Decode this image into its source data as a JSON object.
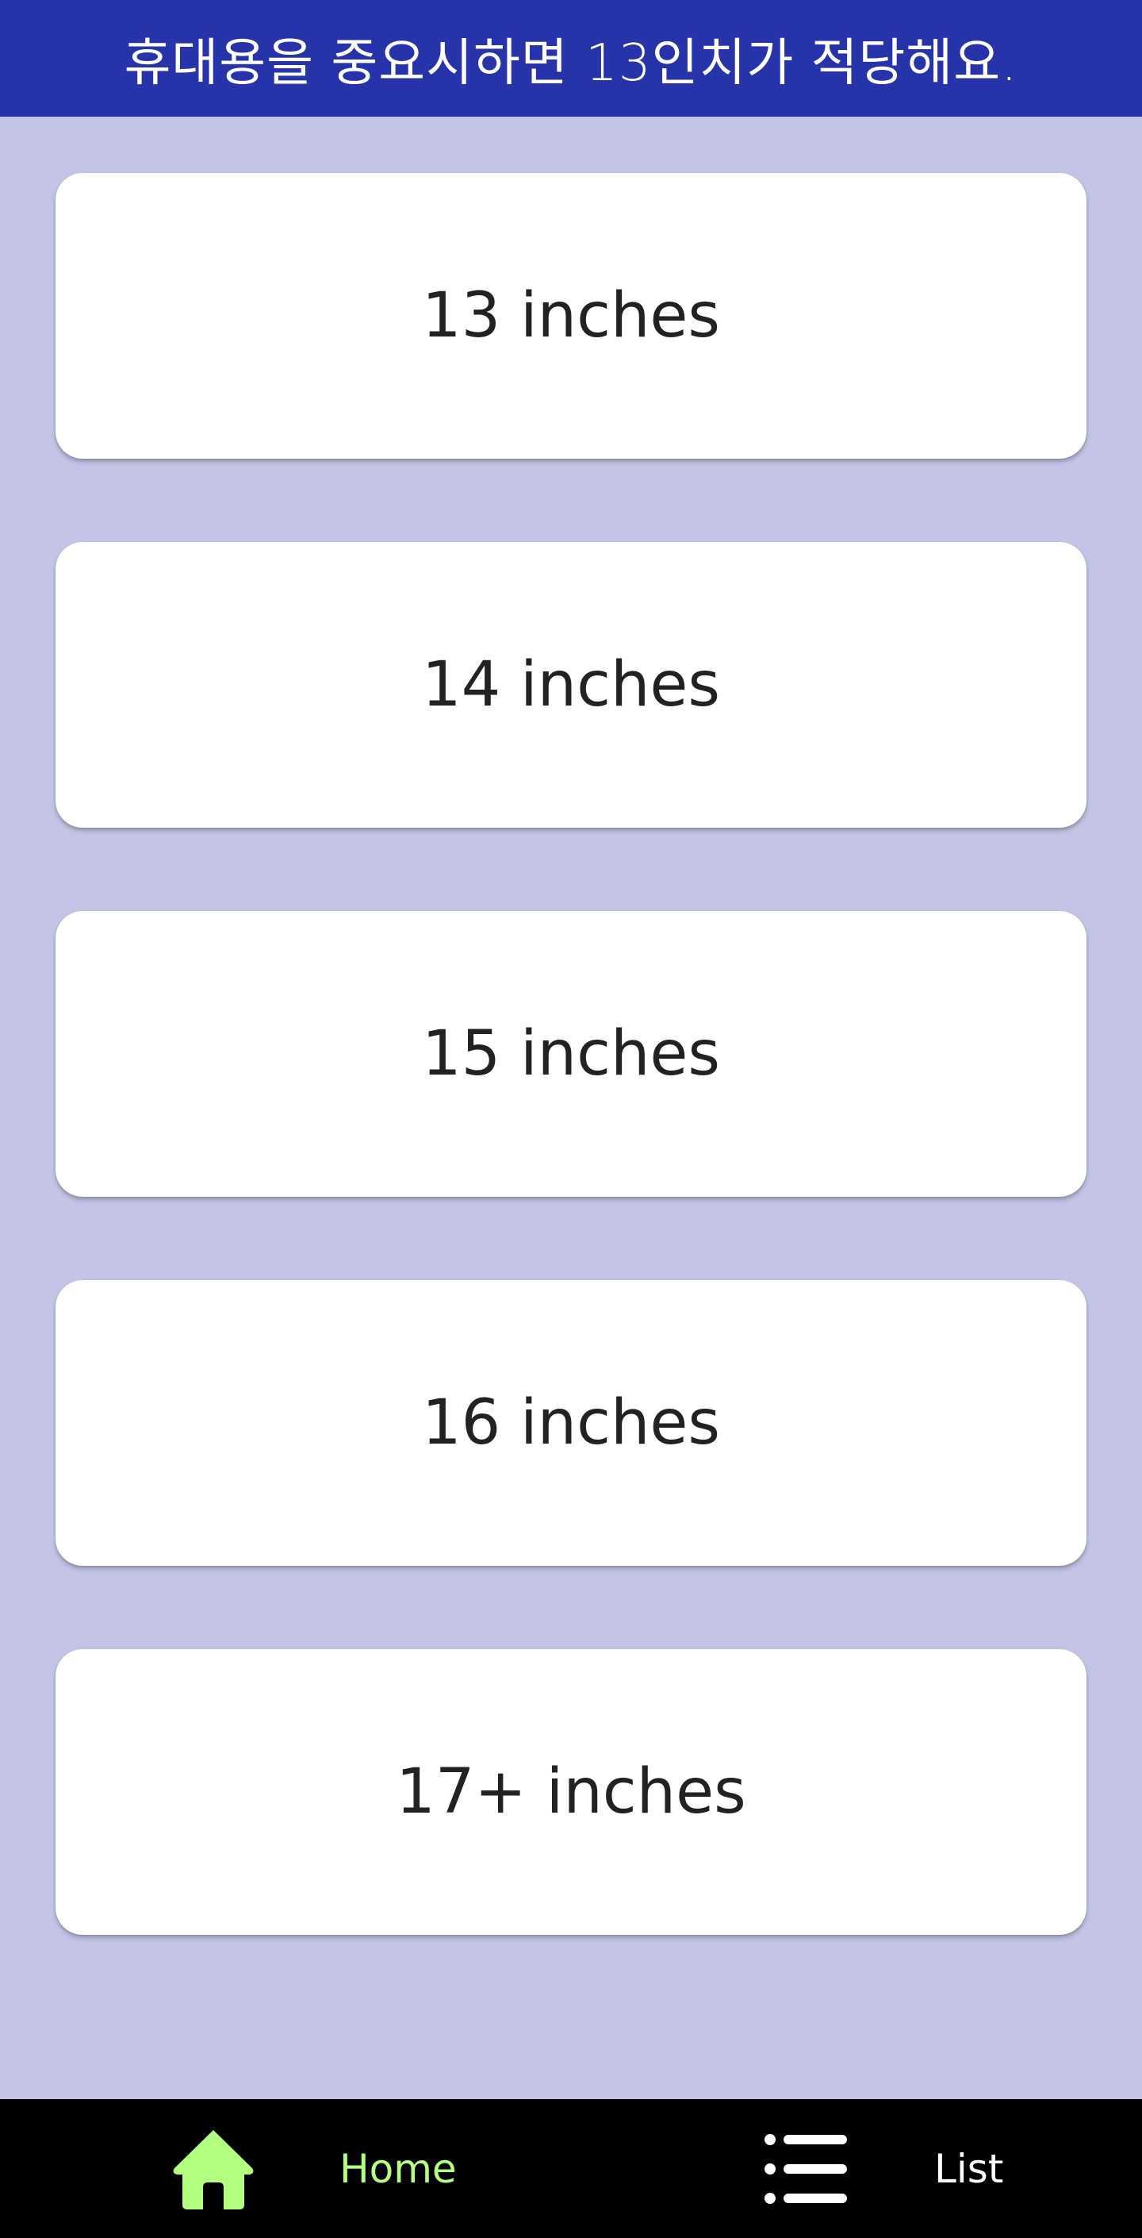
{
  "header": {
    "title": "휴대용을 중요시하면 13인치가 적당해요."
  },
  "options": [
    {
      "label": "13 inches"
    },
    {
      "label": "14 inches"
    },
    {
      "label": "15 inches"
    },
    {
      "label": "16 inches"
    },
    {
      "label": "17+ inches"
    }
  ],
  "bottom_nav": {
    "items": [
      {
        "label": "Home",
        "icon": "home-icon",
        "active": true,
        "color": "#b3ff80"
      },
      {
        "label": "List",
        "icon": "list-icon",
        "active": false,
        "color": "#ffffff"
      }
    ]
  },
  "colors": {
    "header_bg": "#2733a8",
    "page_bg": "#c4c4e6",
    "card_bg": "#ffffff",
    "nav_bg": "#000000",
    "active_accent": "#b3ff80"
  }
}
